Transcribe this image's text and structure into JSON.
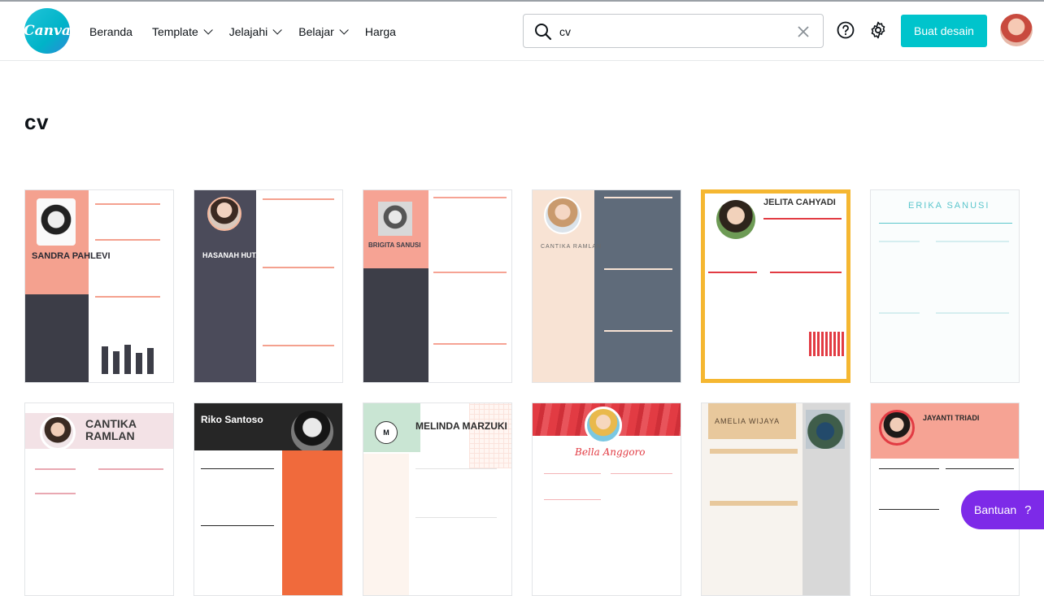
{
  "brand": {
    "logo_text": "Canva",
    "accent": "#00c4cc",
    "help_color": "#7d2ae8"
  },
  "nav": {
    "items": [
      {
        "label": "Beranda",
        "dropdown": false
      },
      {
        "label": "Template",
        "dropdown": true
      },
      {
        "label": "Jelajahi",
        "dropdown": true
      },
      {
        "label": "Belajar",
        "dropdown": true
      },
      {
        "label": "Harga",
        "dropdown": false
      }
    ]
  },
  "search": {
    "value": "cv",
    "icon": "search-icon",
    "clear_icon": "close-icon"
  },
  "header_actions": {
    "create_label": "Buat desain",
    "help_icon": "question-circle-icon",
    "settings_icon": "gear-icon"
  },
  "page": {
    "title": "cv"
  },
  "templates": [
    {
      "name": "SANDRA PAHLEVI",
      "accent": "#f4a18f"
    },
    {
      "name": "HASANAH HUTABARAT",
      "accent": "#4b4b5a"
    },
    {
      "name": "BRIGITA SANUSI",
      "accent": "#f6a394"
    },
    {
      "name": "CANTIKA RAMLAN",
      "accent": "#5f6b7a"
    },
    {
      "name": "JELITA CAHYADI",
      "accent": "#f5b731"
    },
    {
      "name": "ERIKA SANUSI",
      "accent": "#5bc6cc"
    },
    {
      "name": "CANTIKA RAMLAN",
      "accent": "#e9a8b2"
    },
    {
      "name": "Riko Santoso",
      "accent": "#f06a3c"
    },
    {
      "name": "MELINDA MARZUKI",
      "accent": "#c9e5d3"
    },
    {
      "name": "Bella Anggoro",
      "accent": "#e23b43"
    },
    {
      "name": "AMELIA WIJAYA",
      "accent": "#e8c89c"
    },
    {
      "name": "JAYANTI TRIADI",
      "accent": "#f6a394"
    }
  ],
  "help_button": {
    "label": "Bantuan",
    "icon": "?"
  }
}
